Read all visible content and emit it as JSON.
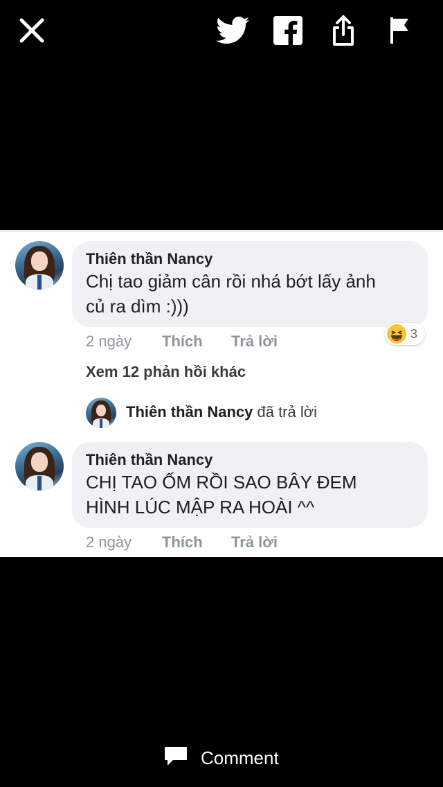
{
  "toolbar": {
    "close_icon": "close-icon",
    "twitter_icon": "twitter-icon",
    "facebook_icon": "facebook-icon",
    "share_icon": "share-icon",
    "report_icon": "flag-icon"
  },
  "comments": [
    {
      "author": "Thiên thần Nancy",
      "text_line1": "Chị tao giảm cân rồi nhá bớt lấy ảnh",
      "text_line2": "củ ra dìm :)))",
      "time": "2 ngày",
      "like": "Thích",
      "reply": "Trả lời",
      "reaction_count": "3"
    },
    {
      "author": "Thiên thần Nancy",
      "text_line1": "CHỊ TAO ỐM RỒI SAO BÂY ĐEM",
      "text_line2": "HÌNH LÚC MẬP RA HOÀI ^^",
      "time": "2 ngày",
      "like": "Thích",
      "reply": "Trả lời"
    }
  ],
  "more_replies": "Xem 12 phản hồi khác",
  "reply_preview": {
    "author": "Thiên thần Nancy",
    "action": "đã trả lời"
  },
  "bottom": {
    "comment_label": "Comment"
  }
}
